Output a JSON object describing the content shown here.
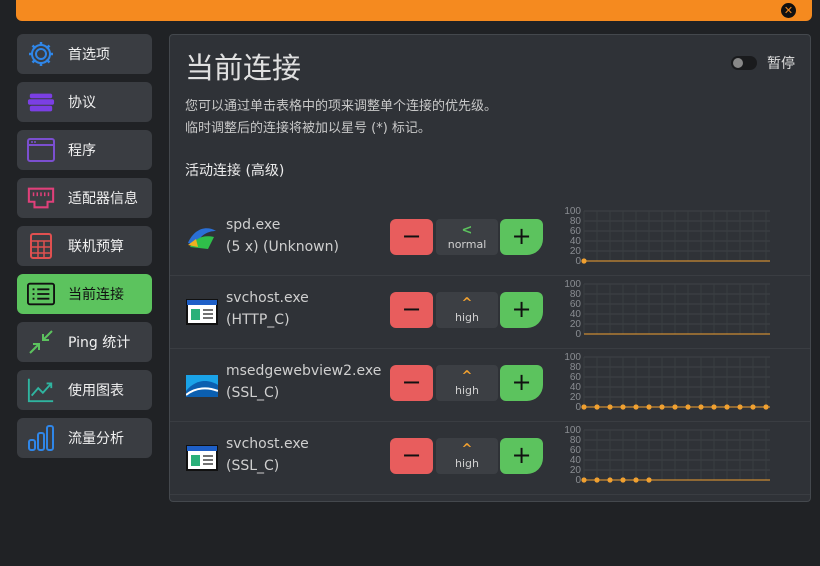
{
  "window": {
    "close_icon": "close-icon"
  },
  "sidebar": {
    "items": [
      {
        "label": "首选项",
        "icon": "gear-icon",
        "color": "#2f86e8",
        "active": false
      },
      {
        "label": "协议",
        "icon": "stack-icon",
        "color": "#7b3fe4",
        "active": false
      },
      {
        "label": "程序",
        "icon": "window-icon",
        "color": "#7b4fd0",
        "active": false
      },
      {
        "label": "适配器信息",
        "icon": "ethernet-icon",
        "color": "#e0407a",
        "active": false
      },
      {
        "label": "联机预算",
        "icon": "calculator-icon",
        "color": "#e05050",
        "active": false
      },
      {
        "label": "当前连接",
        "icon": "list-icon",
        "color": "#111111",
        "active": true
      },
      {
        "label": "Ping 统计",
        "icon": "compress-arrows-icon",
        "color": "#5cc35e",
        "active": false
      },
      {
        "label": "使用图表",
        "icon": "trend-chart-icon",
        "color": "#2fb5a0",
        "active": false
      },
      {
        "label": "流量分析",
        "icon": "bar-chart-icon",
        "color": "#2f86e8",
        "active": false
      }
    ]
  },
  "panel": {
    "title": "当前连接",
    "pause_label": "暂停",
    "description_line1": "您可以通过单击表格中的项来调整单个连接的优先级。",
    "description_line2": "临时调整后的连接将被加以星号 (*) 标记。",
    "section_title": "活动连接 (高级)"
  },
  "buttons": {
    "minus": "−",
    "plus": "+"
  },
  "rows": [
    {
      "name": "spd.exe",
      "sub": "(5 x) (Unknown)",
      "icon": "spd-app-icon",
      "priority": "normal",
      "priority_arrow": "<",
      "arrow_color": "#5cc35e",
      "points": [
        0
      ]
    },
    {
      "name": "svchost.exe",
      "sub": "(HTTP_C)",
      "icon": "svchost-app-icon",
      "priority": "high",
      "priority_arrow": "^",
      "arrow_color": "#f0a030",
      "points": []
    },
    {
      "name": "msedgewebview2.exe",
      "sub": "(SSL_C)",
      "icon": "msedge-app-icon",
      "priority": "high",
      "priority_arrow": "^",
      "arrow_color": "#f0a030",
      "points": [
        0,
        0,
        0,
        0,
        0,
        0,
        0,
        0,
        0,
        0,
        0,
        0,
        0,
        0,
        0
      ]
    },
    {
      "name": "svchost.exe",
      "sub": "(SSL_C)",
      "icon": "svchost-app-icon",
      "priority": "high",
      "priority_arrow": "^",
      "arrow_color": "#f0a030",
      "points": [
        0,
        0,
        0,
        0,
        0,
        0
      ]
    }
  ],
  "chart_axis": {
    "ticks": [
      "100",
      "80",
      "60",
      "40",
      "20",
      "0"
    ],
    "line_color": "#f0a030"
  }
}
